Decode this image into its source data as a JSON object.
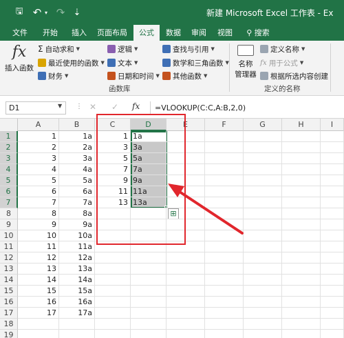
{
  "titlebar": {
    "save_glyph": "🖫",
    "undo_glyph": "↶",
    "undo_caret": "▾",
    "redo_glyph": "↷",
    "customize_glyph": "⇣",
    "title": "新建 Microsoft Excel 工作表 - Ex"
  },
  "tabs": [
    "文件",
    "开始",
    "插入",
    "页面布局",
    "公式",
    "数据",
    "审阅",
    "视图"
  ],
  "search_tab": "搜索",
  "ribbon": {
    "insert_function": {
      "glyph": "fx",
      "label": "插入函数"
    },
    "autosum": "自动求和",
    "recent": "最近使用的函数",
    "financial": "财务",
    "logical": "逻辑",
    "text": "文本",
    "datetime": "日期和时间",
    "lookup": "查找与引用",
    "math": "数学和三角函数",
    "more": "其他函数",
    "library_label": "函数库",
    "name_manager": {
      "line1": "名称",
      "line2": "管理器"
    },
    "define_name": "定义名称",
    "use_in_formula": "用于公式",
    "create_from_selection": "根据所选内容创建",
    "defined_names_label": "定义的名称",
    "colors": {
      "accent": "#217346",
      "ribbon_bg": "#f3f3f3"
    }
  },
  "formula_bar": {
    "name_box": "D1",
    "cancel_glyph": "✕",
    "enter_glyph": "✓",
    "fx_glyph": "fx",
    "formula": "=VLOOKUP(C:C,A:B,2,0)"
  },
  "grid": {
    "columns": [
      "A",
      "B",
      "C",
      "D",
      "E",
      "F",
      "G",
      "H",
      "I"
    ],
    "rows": [
      "1",
      "2",
      "3",
      "4",
      "5",
      "6",
      "7",
      "8",
      "9",
      "10",
      "11",
      "12",
      "13",
      "14",
      "15",
      "16",
      "17",
      "18",
      "19"
    ],
    "col_a": [
      "1",
      "2",
      "3",
      "4",
      "5",
      "6",
      "7",
      "8",
      "9",
      "10",
      "11",
      "12",
      "13",
      "14",
      "15",
      "16",
      "17"
    ],
    "col_b": [
      "1a",
      "2a",
      "3a",
      "4a",
      "5a",
      "6a",
      "7a",
      "8a",
      "9a",
      "10a",
      "11a",
      "12a",
      "13a",
      "14a",
      "15a",
      "16a",
      "17a"
    ],
    "col_c": [
      "1",
      "3",
      "5",
      "7",
      "9",
      "11",
      "13"
    ],
    "col_d": [
      "1a",
      "3a",
      "5a",
      "7a",
      "9a",
      "11a",
      "13a"
    ],
    "quick_analysis_glyph": "⊞",
    "annotation_color": "#e1262c"
  }
}
